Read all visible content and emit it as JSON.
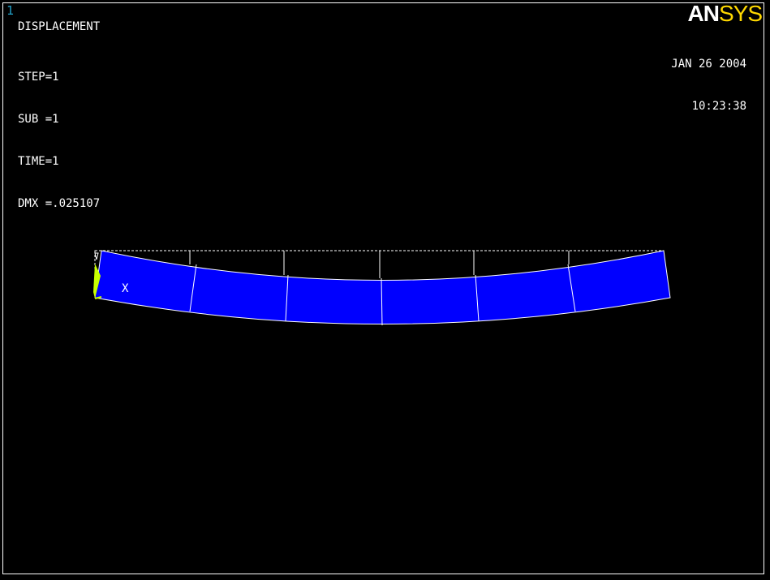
{
  "window": {
    "number": "1"
  },
  "plot": {
    "title": "DISPLACEMENT",
    "info": {
      "step": "STEP=1",
      "sub": "SUB =1",
      "time": "TIME=1",
      "dmx": "DMX =.025107"
    },
    "date": "JAN 26 2004",
    "time": "10:23:38"
  },
  "logo": {
    "text_a": "AN",
    "text_b": "SYS"
  },
  "triad": {
    "x_label": "X"
  },
  "colors": {
    "background": "#000000",
    "deformed_fill": "#0000ff",
    "element_edges": "#ffffff",
    "undeformed_outline": "#ffffff",
    "window_number": "#22a0c8",
    "logo_sys": "#ffd800",
    "support_marker": "#c8ff00"
  }
}
